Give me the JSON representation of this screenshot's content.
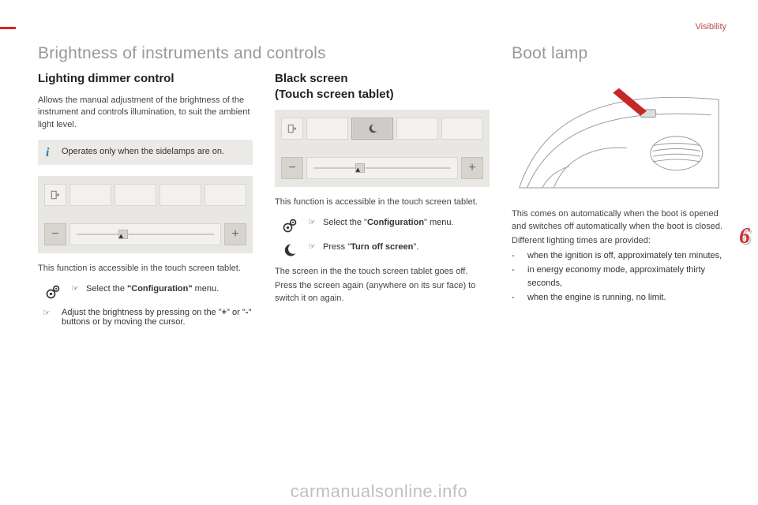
{
  "header": {
    "section": "Visibility"
  },
  "section_number": "6",
  "watermark": "carmanualsonline.info",
  "titles": {
    "main_left": "Brightness of instruments and controls",
    "main_right": "Boot lamp"
  },
  "col1": {
    "subtitle": "Lighting dimmer control",
    "intro": "Allows the manual adjustment of the brightness of the instrument and controls illumination, to suit the ambient light level.",
    "info": "Operates only when the sidelamps are on.",
    "slider": {
      "minus": "−",
      "plus": "+",
      "thumb_pct": 35
    },
    "after_fig": "This function is accessible in the touch screen tablet.",
    "step_config_pre": "Select the ",
    "step_config_bold": "\"Configuration\"",
    "step_config_post": " menu.",
    "step_adjust_pre": "Adjust the brightness by pressing on the \"",
    "step_adjust_b1": "+",
    "step_adjust_mid": "\" or \"",
    "step_adjust_b2": "-",
    "step_adjust_post": "\" buttons or by moving the cursor."
  },
  "col2": {
    "subtitle_l1": "Black screen",
    "subtitle_l2": "(Touch screen tablet)",
    "slider": {
      "minus": "−",
      "plus": "+",
      "thumb_pct": 35
    },
    "after_fig": "This function is accessible in the touch screen tablet.",
    "step_config_pre": "Select the \"",
    "step_config_bold": "Configuration",
    "step_config_post": "\" menu.",
    "step_turnoff_pre": "Press \"",
    "step_turnoff_bold": "Turn off screen",
    "step_turnoff_post": "\".",
    "outro1": "The screen in the the touch screen tablet goes off.",
    "outro2": "Press the screen again (anywhere on its sur face) to switch it on again."
  },
  "col3": {
    "p1": "This comes on automatically when the boot is opened and switches off automatically when the boot is closed.",
    "p2": "Different lighting times are provided:",
    "items": [
      "when the ignition is off, approximately ten minutes,",
      "in energy economy mode, approximately thirty seconds,",
      "when the engine is running, no limit."
    ]
  },
  "bullets": {
    "action": "☞",
    "dash": "-"
  }
}
